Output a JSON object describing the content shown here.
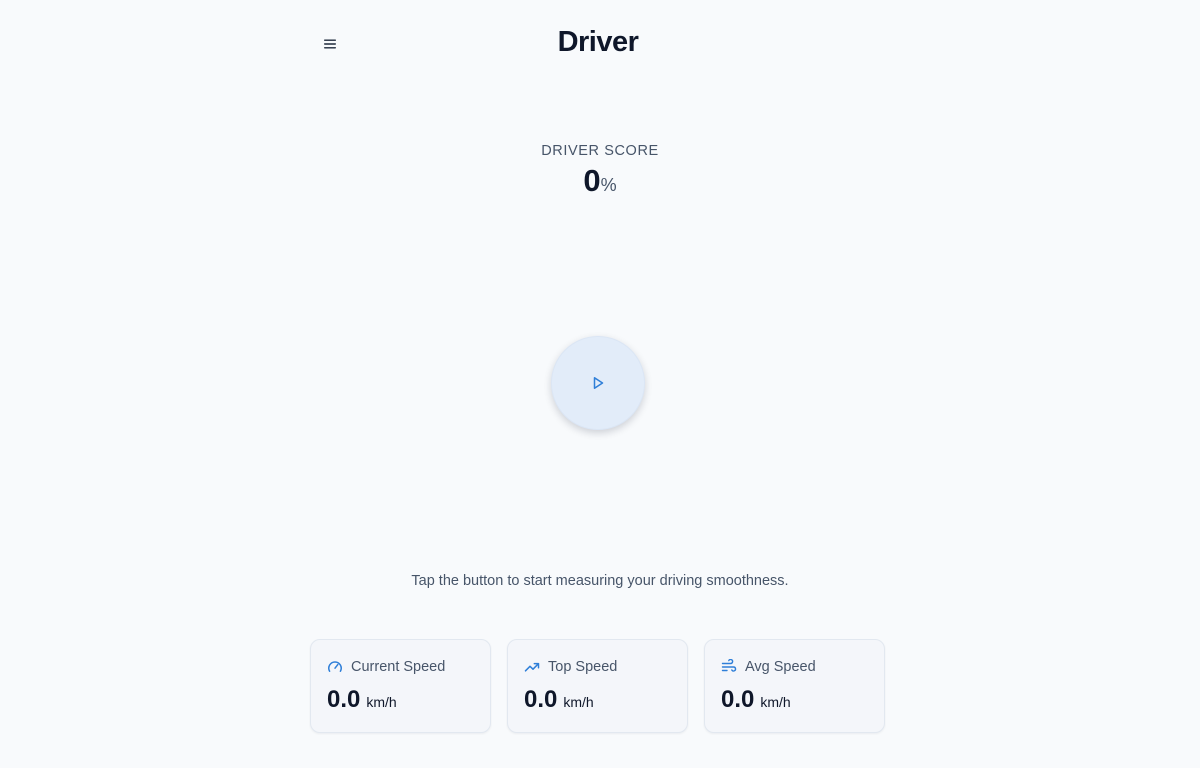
{
  "app": {
    "title": "Driver"
  },
  "header": {
    "menu_icon": "hamburger-menu-icon"
  },
  "score": {
    "label": "Driver Score",
    "value": "0",
    "unit": "%"
  },
  "control": {
    "icon": "play-icon",
    "state": "idle"
  },
  "hint": {
    "text": "Tap the button to start measuring your driving smoothness."
  },
  "stats": [
    {
      "label": "Current Speed",
      "value": "0.0",
      "unit": "km/h",
      "icon": "speedometer-icon"
    },
    {
      "label": "Top Speed",
      "value": "0.0",
      "unit": "km/h",
      "icon": "trending-up-icon"
    },
    {
      "label": "Avg Speed",
      "value": "0.0",
      "unit": "km/h",
      "icon": "wind-icon"
    }
  ],
  "colors": {
    "background": "#f8fafc",
    "accent": "#2f7fd8",
    "play_button_bg": "#e2ecf9",
    "text_primary": "#0f172a",
    "text_secondary": "#475569"
  }
}
